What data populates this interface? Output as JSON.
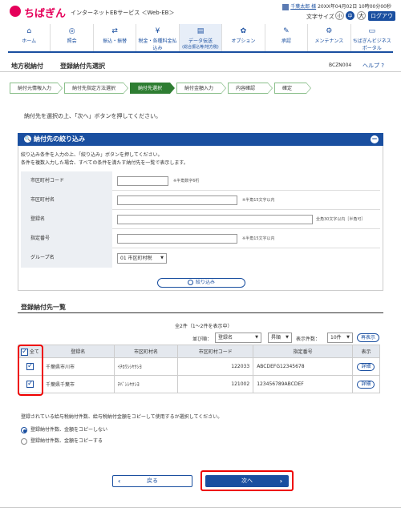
{
  "header": {
    "logo_text": "ちばぎん",
    "service_name": "インターネットEBサービス ＜Web-EB＞",
    "user_name": "千葉太郎 様",
    "datetime": "20XX年04月02日 10時00分00秒",
    "font_size_label": "文字サイズ",
    "font_sizes": [
      "小",
      "中",
      "大"
    ],
    "logout_label": "ログアウト"
  },
  "nav": [
    {
      "label": "ホーム",
      "icon": "home-icon",
      "glyph": "⌂"
    },
    {
      "label": "照会",
      "icon": "search-icon",
      "glyph": "◎"
    },
    {
      "label": "振込・振替",
      "icon": "transfer-icon",
      "glyph": "⇄"
    },
    {
      "label": "税金・各種料金払込み",
      "icon": "tax-icon",
      "glyph": "¥"
    },
    {
      "label": "データ伝送",
      "sub": "(総合振込等/地方税)",
      "icon": "data-transmit-icon",
      "glyph": "▤",
      "active": true
    },
    {
      "label": "オプション",
      "icon": "option-icon",
      "glyph": "✿"
    },
    {
      "label": "承認",
      "icon": "approval-icon",
      "glyph": "✎"
    },
    {
      "label": "メンテナンス",
      "icon": "maintenance-icon",
      "glyph": "⚙"
    },
    {
      "label": "ちばぎんビジネスポータル",
      "icon": "portal-icon",
      "glyph": "▭"
    }
  ],
  "title": {
    "main": "地方税納付",
    "sub": "登録納付先選択",
    "screen_id": "BCZN004",
    "help": "ヘルプ ?"
  },
  "steps": [
    "納付元情報入力",
    "納付先指定方法選択",
    "納付先選択",
    "納付金額入力",
    "内容確認",
    "確定"
  ],
  "active_step": 2,
  "instruction": "納付先を選択の上、「次へ」ボタンを押してください。",
  "filter": {
    "header": "納付先の絞り込み",
    "collapse": "−",
    "note1": "絞り込み条件を入力の上、「絞り込み」ボタンを押してください。",
    "note2": "条件を複数入力した場合、すべての条件を満たす納付先を一覧で表示します。",
    "rows": [
      {
        "label": "市区町村コード",
        "hint": "※半角数字6桁"
      },
      {
        "label": "市区町村名",
        "hint": "※半角15文字以内"
      },
      {
        "label": "登録名",
        "hint": "全角30文字以内［半角可］"
      },
      {
        "label": "指定番号",
        "hint": "※半角15文字以内"
      },
      {
        "label": "グループ名",
        "select": "01 市区町村税"
      }
    ],
    "button": "絞り込み"
  },
  "list": {
    "title": "登録納付先一覧",
    "count": "全2件（1～2件を表示中）",
    "sort_label": "並び順：",
    "sort_value": "登録名",
    "order_value": "昇順",
    "per_page_label": "表示件数：",
    "per_page_value": "10件",
    "redisplay": "再表示",
    "columns": [
      "全て",
      "登録名",
      "市区町村名",
      "市区町村コード",
      "指定番号",
      "表示"
    ],
    "rows": [
      {
        "checked": true,
        "name": "千葉県市川市",
        "city": "ｲﾁｶﾜｼｼﾔｸｼﾖ",
        "code": "122033",
        "no": "ABCDEFG12345678",
        "detail": "詳細"
      },
      {
        "checked": true,
        "name": "千葉県千葉市",
        "city": "ﾁﾊﾞｼｼﾔｸｼﾖ",
        "code": "121002",
        "no": "123456789ABCDEF",
        "detail": "詳細"
      }
    ]
  },
  "copy": {
    "note": "登録されている給与税納付件数、給与税納付金額をコピーして使用するか選択してください。",
    "options": [
      "登録納付件数、金額をコピーしない",
      "登録納付件数、金額をコピーする"
    ],
    "selected": 0
  },
  "buttons": {
    "back": "戻る",
    "next": "次へ"
  }
}
